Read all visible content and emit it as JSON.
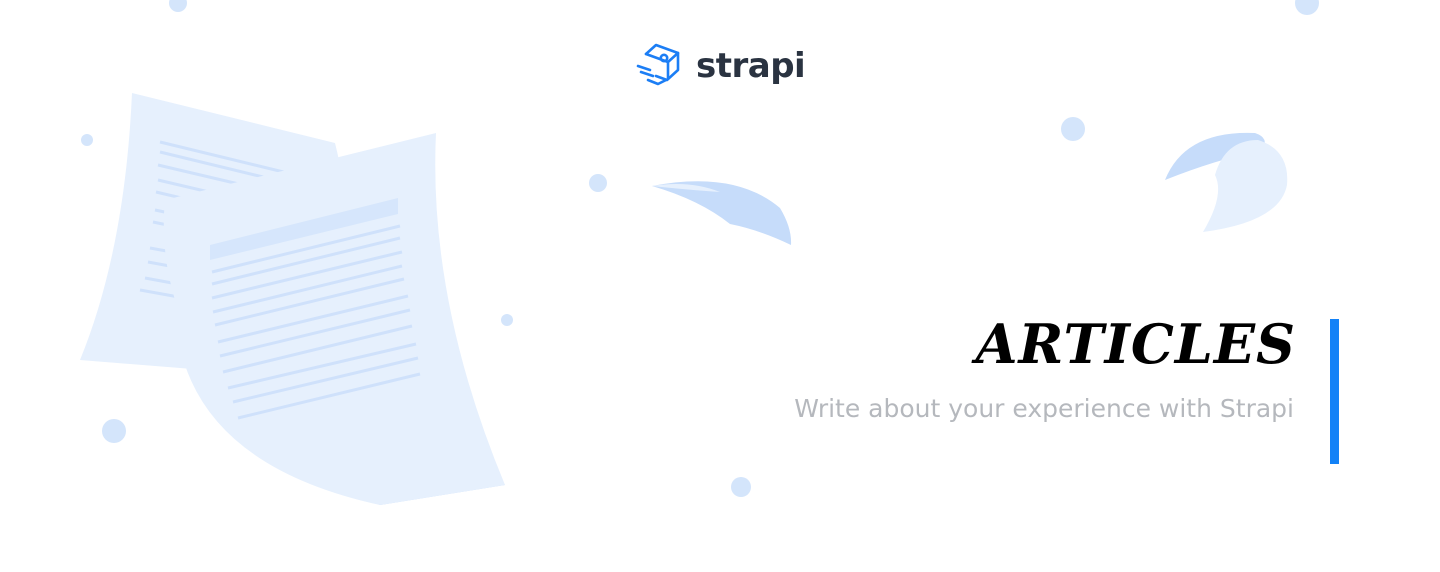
{
  "brand": {
    "name": "strapi",
    "logo_icon": "strapi-logo-icon",
    "logo_color": "#1c7ef5"
  },
  "hero": {
    "title": "ARTICLES",
    "subtitle": "Write about your experience with Strapi"
  },
  "colors": {
    "accent": "#1382f7",
    "paper_light": "#e6f0fd",
    "paper_mid": "#c6dcfa",
    "dot": "#d4e5fb",
    "title": "#000000",
    "subtitle": "#b5b8bd"
  },
  "decor": {
    "icons": [
      "paper-sheet-icon",
      "curled-paper-icon",
      "circle-dot-icon"
    ]
  }
}
